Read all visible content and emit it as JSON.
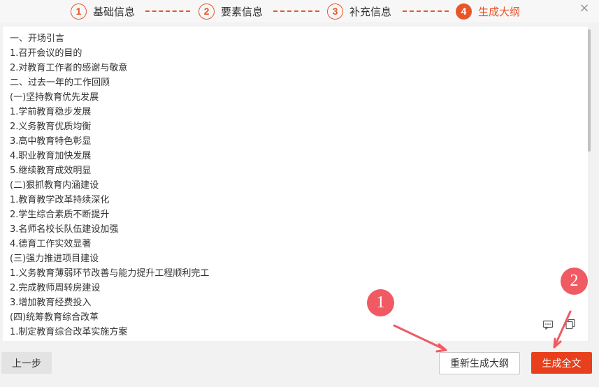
{
  "steps": [
    {
      "num": "1",
      "label": "基础信息",
      "active": false
    },
    {
      "num": "2",
      "label": "要素信息",
      "active": false
    },
    {
      "num": "3",
      "label": "补充信息",
      "active": false
    },
    {
      "num": "4",
      "label": "生成大纲",
      "active": true
    }
  ],
  "close_symbol": "×",
  "outline_lines": [
    "一、开场引言",
    "1.召开会议的目的",
    "2.对教育工作者的感谢与敬意",
    "二、过去一年的工作回顾",
    "(一)坚持教育优先发展",
    "1.学前教育稳步发展",
    "2.义务教育优质均衡",
    "3.高中教育特色彰显",
    "4.职业教育加快发展",
    "5.继续教育成效明显",
    "(二)狠抓教育内涵建设",
    "1.教育教学改革持续深化",
    "2.学生综合素质不断提升",
    "3.名师名校长队伍建设加强",
    "4.德育工作实效显著",
    "(三)强力推进项目建设",
    "1.义务教育薄弱环节改善与能力提升工程顺利完工",
    "2.完成教师周转房建设",
    "3.增加教育经费投入",
    "(四)统筹教育综合改革",
    "1.制定教育综合改革实施方案"
  ],
  "footer": {
    "prev_label": "上一步",
    "regenerate_label": "重新生成大纲",
    "generate_full_label": "生成全文"
  },
  "annotations": {
    "badge1": "1",
    "badge2": "2"
  },
  "icons": {
    "comment": "comment-icon",
    "copy": "copy-icon",
    "close": "close-icon"
  },
  "colors": {
    "accent": "#e8552a",
    "primary_button": "#e8401c",
    "annotation": "#f05a63"
  }
}
